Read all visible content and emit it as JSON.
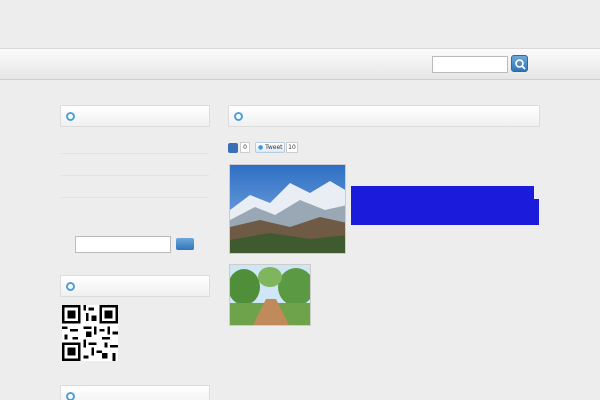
{
  "header": {
    "tagline": "",
    "site_title": ""
  },
  "nav": {
    "items": [
      "",
      ""
    ],
    "search_placeholder": ""
  },
  "sidebar": {
    "categories_title": "",
    "links": [
      "",
      "",
      "",
      ""
    ],
    "search_label": "",
    "search_button": "",
    "qr_title": ""
  },
  "post": {
    "title": "",
    "share_counts": [
      "0",
      "10"
    ],
    "tweet_label": "Tweet",
    "lines": {
      "intro_1": "",
      "intro_2": "",
      "hl_1": "",
      "hl_2": "",
      "hl_3": "",
      "para2_1": "",
      "para2_2": "",
      "para3_1": "",
      "para3_2": "",
      "para3_3": "",
      "para3_4": "",
      "para3_5": "",
      "pink_1": "",
      "pink_2": "",
      "para4_1": "",
      "para4_2": "",
      "para4_3": "",
      "para4_4": ""
    }
  },
  "sidebar_bottom_title": "",
  "colors": {
    "accent": "#2f7dbf",
    "highlight": "#1b1bdc",
    "pink": "#c040c0"
  }
}
